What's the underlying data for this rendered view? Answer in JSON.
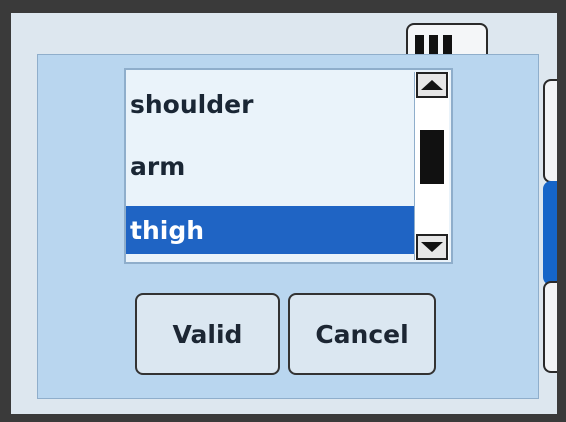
{
  "status": {
    "battery_icon": "battery-icon",
    "battery_level": 3
  },
  "list": {
    "items": [
      {
        "label": "shoulder",
        "selected": false
      },
      {
        "label": "arm",
        "selected": false
      },
      {
        "label": "thigh",
        "selected": true
      }
    ]
  },
  "scrollbar": {
    "up_icon": "arrow-up-icon",
    "down_icon": "arrow-down-icon"
  },
  "buttons": {
    "valid_label": "Valid",
    "cancel_label": "Cancel"
  },
  "colors": {
    "selection": "#1f64c4",
    "dialog_bg": "#b9d6ef",
    "active_tab": "#1565c8"
  }
}
